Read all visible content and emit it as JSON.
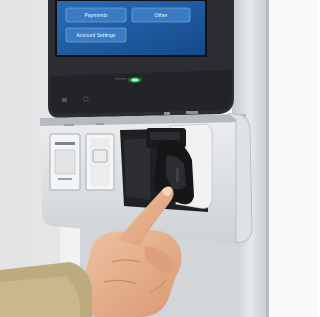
{
  "screen": {
    "buttons": [
      {
        "label": "Payments"
      },
      {
        "label": "Other"
      },
      {
        "label": "Account Settings"
      }
    ]
  },
  "colors": {
    "screen_bg": "#1f5fa8",
    "screen_button": "#3a7cc4",
    "status_led": "#3de06a",
    "kiosk_body": "#e2e4e6",
    "bezel": "#2b2d30",
    "scanner": "#1a1b1d",
    "skin": "#e8b08e",
    "sleeve": "#c9b98a"
  },
  "icons": [
    "card-reader-icon",
    "contactless-icon",
    "fingerprint-icon",
    "printer-icon",
    "led-indicator-icon"
  ]
}
